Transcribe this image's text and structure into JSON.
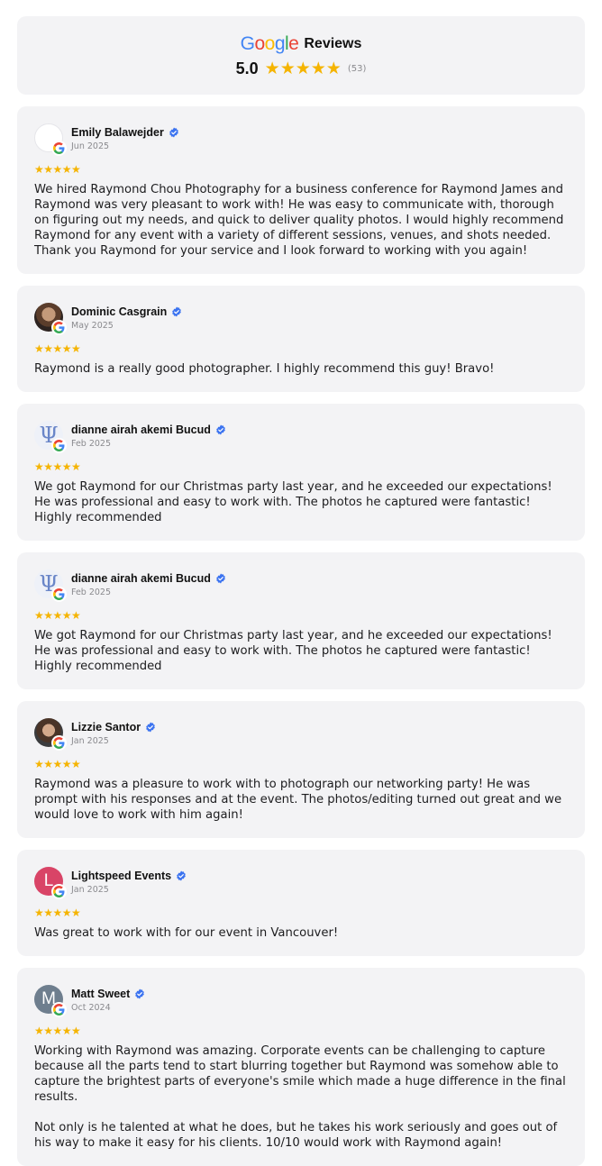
{
  "header": {
    "brand": "Google",
    "title": "Reviews",
    "rating": "5.0",
    "stars": "★★★★★",
    "count": "(53)",
    "brand_colors": [
      "#4285F4",
      "#EA4335",
      "#FBBC05",
      "#4285F4",
      "#34A853",
      "#EA4335"
    ]
  },
  "reviews": [
    {
      "name": "Emily Balawejder",
      "date": "Jun 2025",
      "stars": "★★★★★",
      "avatar": "blank",
      "text": "We hired Raymond Chou Photography for a business conference for Raymond James and Raymond was very pleasant to work with! He was easy to communicate with, thorough on figuring out my needs, and quick to deliver quality photos. I would highly recommend Raymond for any event with a variety of different sessions, venues, and shots needed. Thank you Raymond for your service and I look forward to working with you again!"
    },
    {
      "name": "Dominic Casgrain",
      "date": "May 2025",
      "stars": "★★★★★",
      "avatar": "photo",
      "text": "Raymond is a really good photographer. I highly recommend this guy! Bravo!"
    },
    {
      "name": "dianne airah akemi Bucud",
      "date": "Feb 2025",
      "stars": "★★★★★",
      "avatar": "psi",
      "avatar_glyph": "Ψ",
      "text": "We got Raymond for our Christmas party last year, and he exceeded our expectations! He was professional and easy to work with. The photos he captured were fantastic! Highly recommended"
    },
    {
      "name": "dianne airah akemi Bucud",
      "date": "Feb 2025",
      "stars": "★★★★★",
      "avatar": "psi",
      "avatar_glyph": "Ψ",
      "text": "We got Raymond for our Christmas party last year, and he exceeded our expectations! He was professional and easy to work with. The photos he captured were fantastic! Highly recommended"
    },
    {
      "name": "Lizzie Santor",
      "date": "Jan 2025",
      "stars": "★★★★★",
      "avatar": "photo",
      "text": "Raymond was a pleasure to work with to photograph our networking party! He was prompt with his responses and at the event. The photos/editing turned out great and we would love to work with him again!"
    },
    {
      "name": "Lightspeed Events",
      "date": "Jan 2025",
      "stars": "★★★★★",
      "avatar": "letter",
      "avatar_glyph": "L",
      "avatar_color": "#d94467",
      "text": "Was great to work with for our event in Vancouver!"
    },
    {
      "name": "Matt Sweet",
      "date": "Oct 2024",
      "stars": "★★★★★",
      "avatar": "letter",
      "avatar_glyph": "M",
      "avatar_color": "#6e7e8e",
      "text": "Working with Raymond was amazing. Corporate events can be challenging to capture because all the parts tend to start blurring together but Raymond was somehow able to capture the brightest parts of everyone's smile which made a huge difference in the final results.\n\nNot only is he talented at what he does, but he takes his work seriously and goes out of his way to make it easy for his clients. 10/10 would work with Raymond again!"
    }
  ]
}
